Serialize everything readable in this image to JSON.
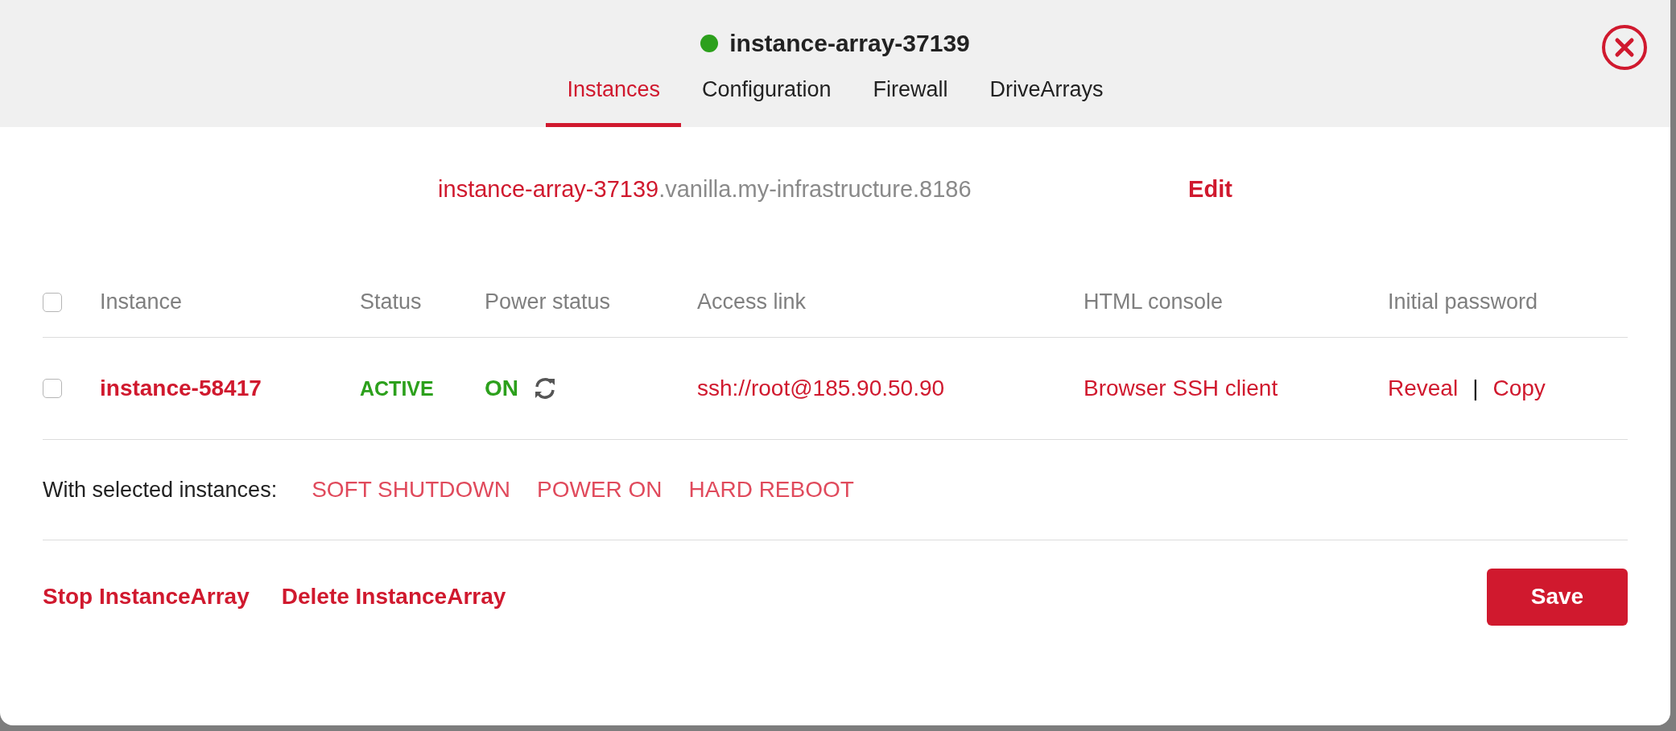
{
  "dialog": {
    "title": "instance-array-37139"
  },
  "tabs": [
    {
      "label": "Instances",
      "selected": true
    },
    {
      "label": "Configuration",
      "selected": false
    },
    {
      "label": "Firewall",
      "selected": false
    },
    {
      "label": "DriveArrays",
      "selected": false
    }
  ],
  "hostname": {
    "label": "instance-array-37139",
    "suffix": ".vanilla.my-infrastructure.8186",
    "edit": "Edit"
  },
  "table": {
    "select_all": {
      "checked": false
    },
    "columns": [
      "Instance",
      "Status",
      "Power status",
      "Access link",
      "HTML console",
      "Initial password"
    ],
    "rows": [
      {
        "checked": false,
        "instance": "instance-58417",
        "status": "ACTIVE",
        "power_status": "ON",
        "access_link": "ssh://root@185.90.50.90",
        "html_console": "Browser SSH client",
        "password_actions": [
          "Reveal",
          "Copy"
        ],
        "separator": "|"
      }
    ]
  },
  "bulk_actions": {
    "label": "With selected instances:",
    "actions": [
      "SOFT SHUTDOWN",
      "POWER ON",
      "HARD REBOOT"
    ]
  },
  "footer": {
    "links": [
      "Stop InstanceArray",
      "Delete InstanceArray"
    ],
    "save": "Save"
  }
}
